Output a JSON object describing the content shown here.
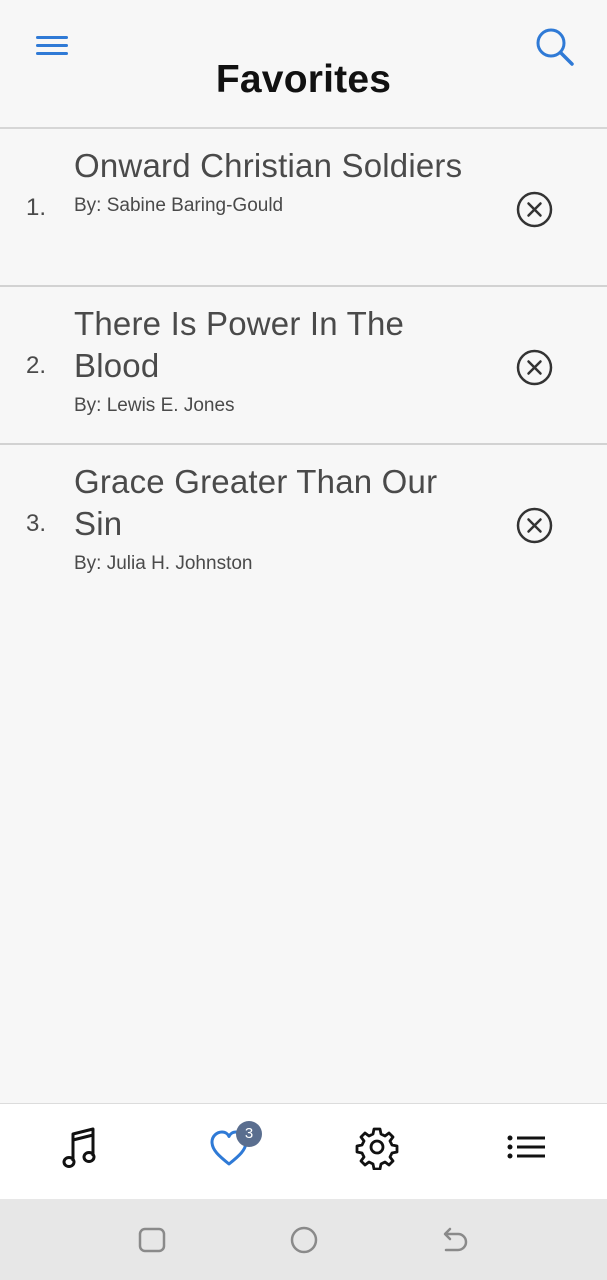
{
  "header": {
    "title": "Favorites",
    "menu_icon": "hamburger-menu-icon",
    "search_icon": "search-icon",
    "accent_color": "#2f7ad6"
  },
  "favorites": [
    {
      "number": "1.",
      "title": "Onward Christian Soldiers",
      "author": "By: Sabine Baring-Gould",
      "remove_icon": "remove-circle-x-icon"
    },
    {
      "number": "2.",
      "title": "There Is Power In The Blood",
      "author": "By: Lewis E. Jones",
      "remove_icon": "remove-circle-x-icon"
    },
    {
      "number": "3.",
      "title": "Grace Greater Than Our Sin",
      "author": "By: Julia H. Johnston",
      "remove_icon": "remove-circle-x-icon"
    }
  ],
  "tabbar": {
    "tabs": [
      {
        "name": "songs",
        "icon": "music-note-icon",
        "active": false
      },
      {
        "name": "favorites",
        "icon": "heart-icon",
        "active": true,
        "badge": "3"
      },
      {
        "name": "settings",
        "icon": "gear-icon",
        "active": false
      },
      {
        "name": "list",
        "icon": "list-icon",
        "active": false
      }
    ]
  },
  "system_nav": {
    "buttons": [
      "recent-apps-icon",
      "home-icon",
      "back-icon"
    ]
  }
}
